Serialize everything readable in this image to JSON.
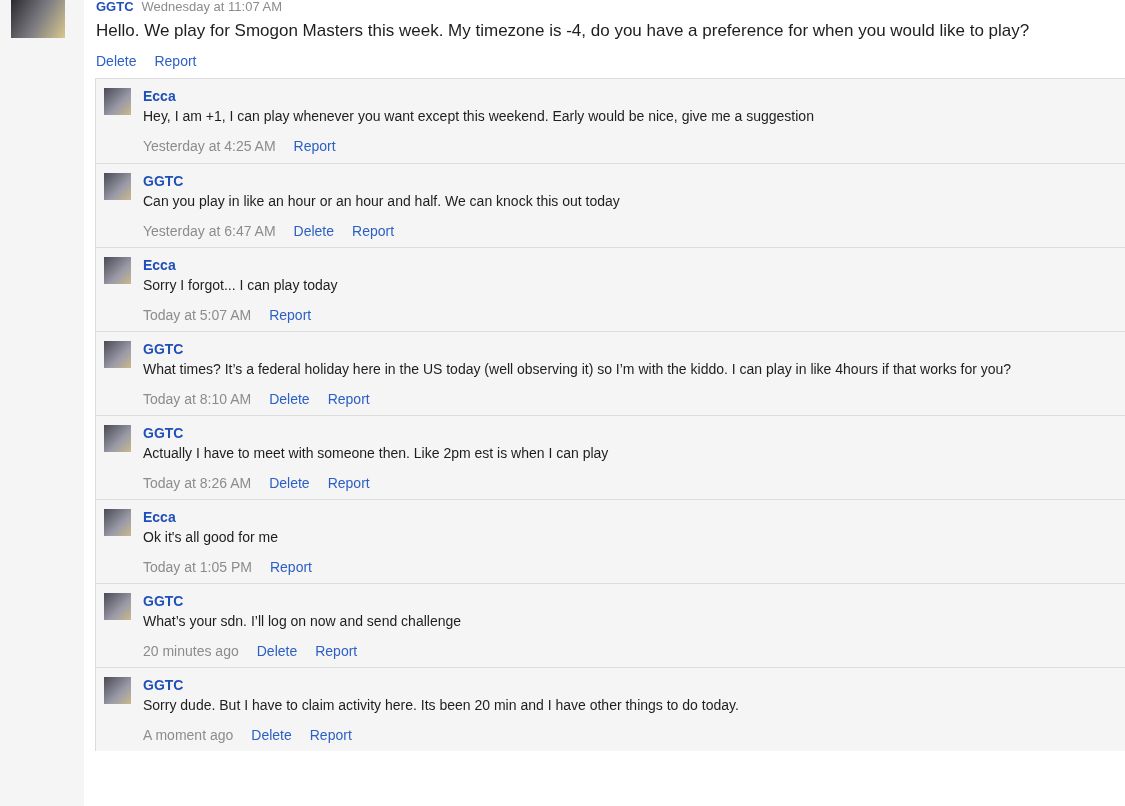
{
  "post": {
    "author": "GGTC",
    "time": "Wednesday at 11:07 AM",
    "text": "Hello. We play for Smogon Masters this week. My timezone is -4, do you have a preference for when you would like to play?",
    "actions": [
      "Delete",
      "Report"
    ]
  },
  "replies": [
    {
      "author": "Ecca",
      "text": "Hey, I am +1, I can play whenever you want except this weekend. Early would be nice, give me a suggestion",
      "time": "Yesterday at 4:25 AM",
      "actions": [
        "Report"
      ]
    },
    {
      "author": "GGTC",
      "text": "Can you play in like an hour or an hour and half. We can knock this out today",
      "time": "Yesterday at 6:47 AM",
      "actions": [
        "Delete",
        "Report"
      ]
    },
    {
      "author": "Ecca",
      "text": "Sorry I forgot... I can play today",
      "time": "Today at 5:07 AM",
      "actions": [
        "Report"
      ]
    },
    {
      "author": "GGTC",
      "text": "What times? It’s a federal holiday here in the US today (well observing it) so I’m with the kiddo. I can play in like 4hours if that works for you?",
      "time": "Today at 8:10 AM",
      "actions": [
        "Delete",
        "Report"
      ]
    },
    {
      "author": "GGTC",
      "text": "Actually I have to meet with someone then. Like 2pm est is when I can play",
      "time": "Today at 8:26 AM",
      "actions": [
        "Delete",
        "Report"
      ]
    },
    {
      "author": "Ecca",
      "text": "Ok it's all good for me",
      "time": "Today at 1:05 PM",
      "actions": [
        "Report"
      ]
    },
    {
      "author": "GGTC",
      "text": "What’s your sdn. I’ll log on now and send challenge",
      "time": "20 minutes ago",
      "actions": [
        "Delete",
        "Report"
      ]
    },
    {
      "author": "GGTC",
      "text": "Sorry dude. But I have to claim activity here. Its been 20 min and I have other things to do today.",
      "time": "A moment ago",
      "actions": [
        "Delete",
        "Report"
      ]
    }
  ]
}
